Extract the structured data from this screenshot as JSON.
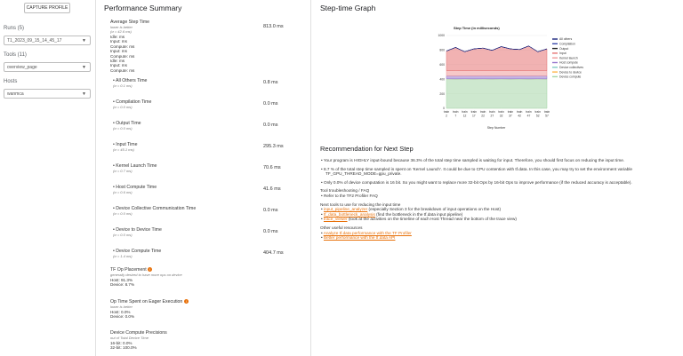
{
  "sidebar": {
    "capture_label": "CAPTURE PROFILE",
    "runs_label": "Runs (5)",
    "runs_value": "T1_2023_09_15_14_45_17",
    "tools_label": "Tools (11)",
    "tools_value": "overview_page",
    "hosts_label": "Hosts",
    "hosts_value": "wanmca"
  },
  "summary": {
    "title": "Performance Summary",
    "avg_step": {
      "name": "Average Step Time",
      "note": "lower is better",
      "sigma": "(σ = 42.6 ms)",
      "value": "813.0 ms",
      "breakdown": [
        "Idle: ms",
        "Input: ms",
        "Compute: ms",
        "Input: ms",
        "Compute: ms",
        "Idle: ms",
        "Input: ms",
        "Compute: ms"
      ]
    },
    "metrics": [
      {
        "name": "All Others Time",
        "sigma": "(σ = 0.1 ms)",
        "value": "0.8 ms"
      },
      {
        "name": "Compilation Time",
        "sigma": "(σ = 0.0 ms)",
        "value": "0.0 ms"
      },
      {
        "name": "Output Time",
        "sigma": "(σ = 0.0 ms)",
        "value": "0.0 ms"
      },
      {
        "name": "Input Time",
        "sigma": "(σ = 45.1 ms)",
        "value": "295.3 ms"
      },
      {
        "name": "Kernel Launch Time",
        "sigma": "(σ = 0.7 ms)",
        "value": "70.6 ms"
      },
      {
        "name": "Host Compute Time",
        "sigma": "(σ = 0.6 ms)",
        "value": "41.6 ms"
      },
      {
        "name": "Device Collective Communication Time",
        "sigma": "(σ = 0.0 ms)",
        "value": "0.0 ms"
      },
      {
        "name": "Device to Device Time",
        "sigma": "(σ = 0.0 ms)",
        "value": "0.0 ms"
      },
      {
        "name": "Device Compute Time",
        "sigma": "(σ = 1.4 ms)",
        "value": "404.7 ms"
      }
    ],
    "op_placement": {
      "name": "TF Op Placement",
      "note": "generally desired to have more ops on device",
      "lines": [
        "Host: 91.3%",
        "Device: 8.7%"
      ]
    },
    "eager": {
      "name": "Op Time Spent on Eager Execution",
      "note": "lower is better",
      "lines": [
        "Host: 0.0%",
        "Device: 0.0%"
      ]
    },
    "precision": {
      "name": "Device Compute Precisions",
      "note": "out of Total Device Time",
      "lines": [
        "16-bit: 0.0%",
        "32-bit: 100.0%"
      ]
    }
  },
  "graph": {
    "title": "Step-time Graph"
  },
  "chart_data": {
    "type": "area",
    "title": "Step Time (in milliseconds)",
    "xlabel": "Step Number",
    "ylabel": "",
    "ylim": [
      0,
      1000
    ],
    "yticks": [
      0,
      200,
      400,
      600,
      800,
      1000
    ],
    "categories": [
      "train 2",
      "train 7",
      "train 12",
      "train 17",
      "train 22",
      "train 27",
      "train 32",
      "train 37",
      "train 42",
      "train 47",
      "train 52",
      "train 57"
    ],
    "legend_position": "right",
    "series": [
      {
        "name": "All others",
        "color": "#1a237e",
        "values": [
          1,
          1,
          1,
          1,
          1,
          1,
          1,
          1,
          1,
          1,
          1,
          1
        ]
      },
      {
        "name": "Compilation",
        "color": "#3949ab",
        "values": [
          0,
          0,
          0,
          0,
          0,
          0,
          0,
          0,
          0,
          0,
          0,
          0
        ]
      },
      {
        "name": "Output",
        "color": "#212121",
        "values": [
          0,
          0,
          0,
          0,
          0,
          0,
          0,
          0,
          0,
          0,
          0,
          0
        ]
      },
      {
        "name": "Input",
        "color": "#e57373",
        "values": [
          270,
          320,
          260,
          300,
          310,
          280,
          330,
          300,
          290,
          340,
          260,
          300
        ]
      },
      {
        "name": "Kernel launch",
        "color": "#ef9a9a",
        "values": [
          70,
          71,
          70,
          71,
          70,
          71,
          70,
          71,
          70,
          71,
          70,
          71
        ]
      },
      {
        "name": "Host compute",
        "color": "#9575cd",
        "values": [
          42,
          41,
          42,
          41,
          42,
          41,
          42,
          41,
          42,
          41,
          42,
          41
        ]
      },
      {
        "name": "Device collectives",
        "color": "#80cbc4",
        "values": [
          0,
          0,
          0,
          0,
          0,
          0,
          0,
          0,
          0,
          0,
          0,
          0
        ]
      },
      {
        "name": "Device to device",
        "color": "#ffb74d",
        "values": [
          0,
          0,
          0,
          0,
          0,
          0,
          0,
          0,
          0,
          0,
          0,
          0
        ]
      },
      {
        "name": "Device compute",
        "color": "#a5d6a7",
        "values": [
          405,
          404,
          405,
          404,
          405,
          404,
          405,
          404,
          405,
          404,
          405,
          404
        ]
      }
    ]
  },
  "reco": {
    "title": "Recommendation for Next Step",
    "items": [
      "Your program is HIGHLY input-bound because 36.3% of the total step time sampled is waiting for input. Therefore, you should first focus on reducing the input time.",
      "8.7 % of the total step time sampled is spent on 'Kernel Launch'. It could be due to CPU contention with tf.data. In this case, you may try to set the environment variable TF_GPU_THREAD_MODE=gpu_private.",
      "Only 0.0% of device computation is 16 bit. So you might want to replace more 32-bit Ops by 16-bit Ops to improve performance (if the reduced accuracy is acceptable)."
    ],
    "tool_header": "Tool troubleshooting / FAQ",
    "tool_item": "Refer to the TF2 Profiler FAQ",
    "next_header": "Next tools to use for reducing the input time",
    "next_tools": [
      {
        "link": "input_pipeline_analyzer",
        "text": " (especially Section 3 for the breakdown of input operations on the Host)"
      },
      {
        "link": "tf_data_bottleneck_analysis",
        "text": " (find the bottleneck in the tf.data input pipeline)"
      },
      {
        "link": "trace_viewer",
        "text": " (look at the activities on the timeline of each Host Thread near the bottom of the trace view)"
      }
    ],
    "other_header": "Other useful resources",
    "other_links": [
      "Analyze tf.data performance with the TF Profiler",
      "Better performance with the tf.data API"
    ]
  }
}
